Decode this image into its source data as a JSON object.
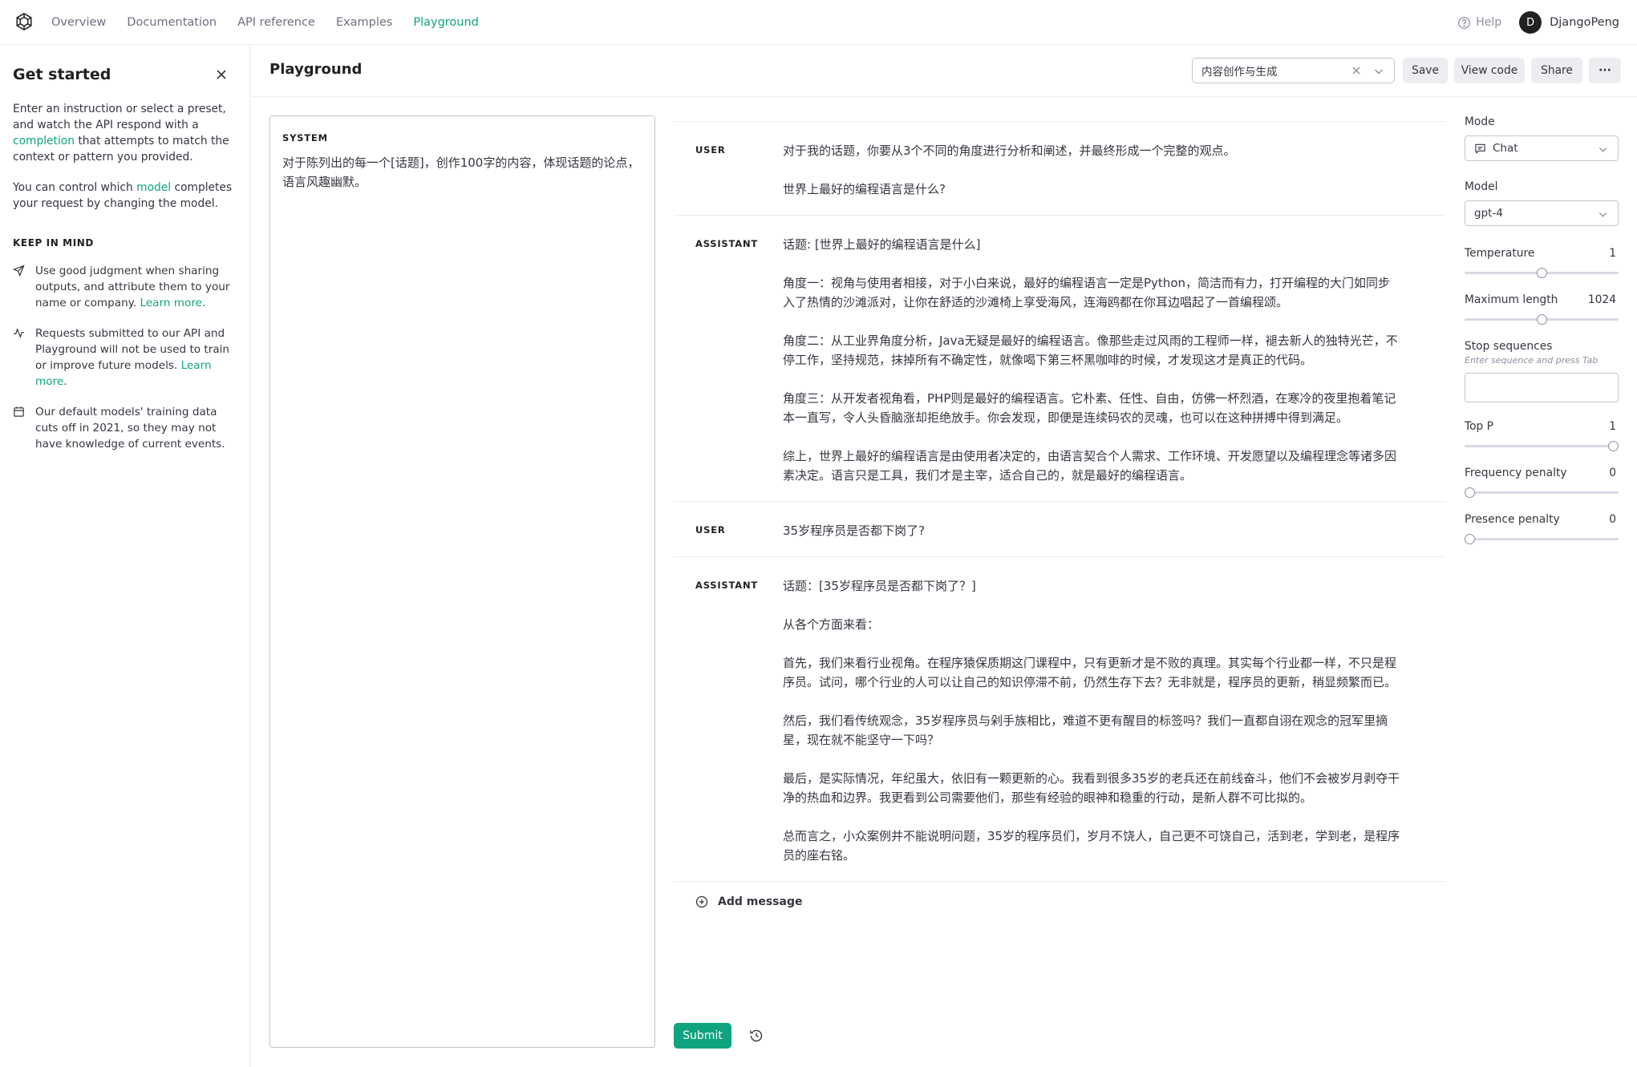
{
  "nav": {
    "links": [
      "Overview",
      "Documentation",
      "API reference",
      "Examples",
      "Playground"
    ],
    "active": "Playground",
    "help": "Help",
    "avatar_initial": "D",
    "username": "DjangoPeng"
  },
  "sidebar": {
    "title": "Get started",
    "intro_part1": "Enter an instruction or select a preset, and watch the API respond with a ",
    "intro_link": "completion",
    "intro_part2": " that attempts to match the context or pattern you provided.",
    "model_part1": "You can control which ",
    "model_link": "model",
    "model_part2": " completes your request by changing the model.",
    "keep_title": "KEEP IN MIND",
    "keep_items": [
      {
        "text": "Use good judgment when sharing outputs, and attribute them to your name or company. ",
        "link": "Learn more",
        "tail": "."
      },
      {
        "text": "Requests submitted to our API and Playground will not be used to train or improve future models. ",
        "link": "Learn more",
        "tail": "."
      },
      {
        "text": "Our default models' training data cuts off in 2021, so they may not have knowledge of current events.",
        "link": "",
        "tail": ""
      }
    ]
  },
  "header": {
    "title": "Playground",
    "preset": "内容创作与生成",
    "save": "Save",
    "view_code": "View code",
    "share": "Share",
    "more": "···"
  },
  "system": {
    "label": "SYSTEM",
    "text": "对于陈列出的每一个[话题]，创作100字的内容，体现话题的论点，语言风趣幽默。"
  },
  "messages": [
    {
      "role": "USER",
      "paragraphs": [
        "对于我的话题，你要从3个不同的角度进行分析和阐述，并最终形成一个完整的观点。",
        "世界上最好的编程语言是什么?"
      ]
    },
    {
      "role": "ASSISTANT",
      "paragraphs": [
        "话题: [世界上最好的编程语言是什么]",
        "角度一：视角与使用者相接，对于小白来说，最好的编程语言一定是Python，简洁而有力，打开编程的大门如同步入了热情的沙滩派对，让你在舒适的沙滩椅上享受海风，连海鸥都在你耳边唱起了一首编程颂。",
        "角度二：从工业界角度分析，Java无疑是最好的编程语言。像那些走过风雨的工程师一样，褪去新人的独特光芒，不停工作，坚持规范，抹掉所有不确定性，就像喝下第三杯黑咖啡的时候，才发现这才是真正的代码。",
        "角度三：从开发者视角看，PHP则是最好的编程语言。它朴素、任性、自由，仿佛一杯烈酒，在寒冷的夜里抱着笔记本一直写，令人头昏脑涨却拒绝放手。你会发现，即便是连续码农的灵魂，也可以在这种拼搏中得到满足。",
        "综上，世界上最好的编程语言是由使用者决定的，由语言契合个人需求、工作环境、开发愿望以及编程理念等诸多因素决定。语言只是工具，我们才是主宰，适合自己的，就是最好的编程语言。"
      ]
    },
    {
      "role": "USER",
      "paragraphs": [
        "35岁程序员是否都下岗了?"
      ]
    },
    {
      "role": "ASSISTANT",
      "paragraphs": [
        "话题：[35岁程序员是否都下岗了？]",
        "从各个方面来看：",
        "首先，我们来看行业视角。在程序猿保质期这门课程中，只有更新才是不败的真理。其实每个行业都一样，不只是程序员。试问，哪个行业的人可以让自己的知识停滞不前，仍然生存下去？无非就是，程序员的更新，稍显频繁而已。",
        "然后，我们看传统观念，35岁程序员与剁手族相比，难道不更有醒目的标签吗？我们一直都自诩在观念的冠军里摘星，现在就不能坚守一下吗？",
        "最后，是实际情况，年纪虽大，依旧有一颗更新的心。我看到很多35岁的老兵还在前线奋斗，他们不会被岁月剥夺干净的热血和边界。我更看到公司需要他们，那些有经验的眼神和稳重的行动，是新人群不可比拟的。",
        "总而言之，小众案例并不能说明问题，35岁的程序员们，岁月不饶人，自己更不可饶自己，活到老，学到老，是程序员的座右铭。"
      ]
    }
  ],
  "actions": {
    "add_message": "Add message",
    "submit": "Submit"
  },
  "settings": {
    "mode_label": "Mode",
    "mode_value": "Chat",
    "model_label": "Model",
    "model_value": "gpt-4",
    "temperature_label": "Temperature",
    "temperature": "1",
    "temperature_fraction": 0.5,
    "max_length_label": "Maximum length",
    "max_length": "1024",
    "max_length_fraction": 0.5,
    "stop_label": "Stop sequences",
    "stop_hint": "Enter sequence and press Tab",
    "top_p_label": "Top P",
    "top_p": "1",
    "top_p_fraction": 1,
    "freq_label": "Frequency penalty",
    "freq": "0",
    "freq_fraction": 0,
    "presence_label": "Presence penalty",
    "presence": "0",
    "presence_fraction": 0
  },
  "colors": {
    "accent": "#10a37f",
    "text": "#353740",
    "border": "#c5c5d2"
  }
}
